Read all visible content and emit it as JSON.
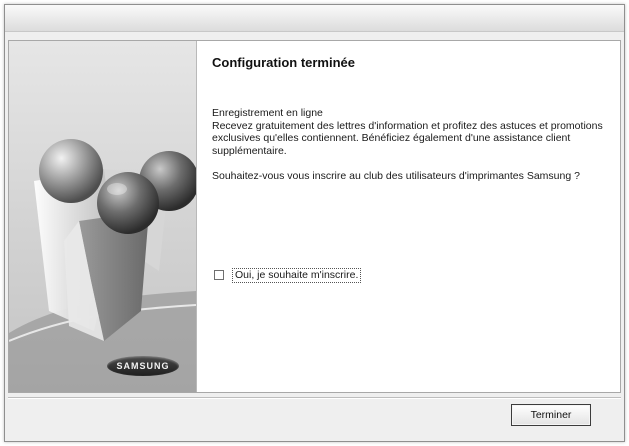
{
  "dialog": {
    "heading": "Configuration terminée",
    "paragraph1": "Enregistrement en ligne\nRecevez gratuitement des lettres d'information et profitez des astuces et promotions exclusives qu'elles contiennent. Bénéficiez également d'une assistance client supplémentaire.",
    "paragraph2": "Souhaitez-vous vous inscrire au club des utilisateurs d'imprimantes Samsung ?",
    "checkbox": {
      "label": "Oui, je souhaite m'inscrire.",
      "checked": false
    },
    "finish_button": "Terminer"
  },
  "brand": {
    "logo_text": "SAMSUNG"
  }
}
